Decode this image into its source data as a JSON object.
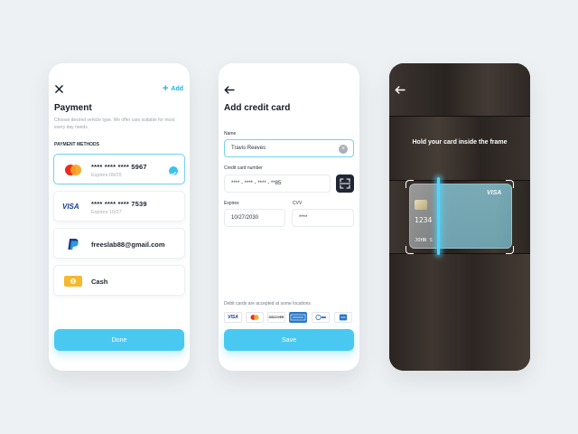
{
  "payment_screen": {
    "title": "Payment",
    "add_label": "Add",
    "description": "Choose desired vehicle type. We offer cars suitable for most every day needs.",
    "section_label": "PAYMENT METHODS",
    "methods": [
      {
        "brand": "mastercard",
        "number": "**** **** **** 5967",
        "expires": "Expires 09/25",
        "selected": true
      },
      {
        "brand": "VISA",
        "number": "**** **** **** 7539",
        "expires": "Expires 10/27",
        "selected": false
      },
      {
        "brand": "paypal",
        "label": "freeslab88@gmail.com"
      },
      {
        "brand": "cash",
        "label": "Cash"
      }
    ],
    "done_label": "Done"
  },
  "add_card_screen": {
    "title": "Add credit card",
    "name_label": "Name",
    "name_value": "Travis Reeves",
    "card_number_label": "Credit card number",
    "card_number_value": "**** - **** - **** - **85",
    "expires_label": "Expires",
    "expires_value": "10/27/2030",
    "cvv_label": "CVV",
    "cvv_value": "****",
    "accepted_note": "Debit cards are accepted at some locations",
    "brands": [
      "VISA",
      "mastercard",
      "DISCOVER",
      "AMERICAN EXPRESS",
      "diners club",
      "AMEX"
    ],
    "visa_brand_text": "VISA",
    "discover_brand_text": "DISCOVER",
    "save_label": "Save"
  },
  "scan_screen": {
    "instruction": "Hold your card inside the frame",
    "card_brand": "VISA",
    "card_digits": "1234",
    "card_holder": "JOHN S"
  },
  "colors": {
    "accent": "#49c9f1",
    "background": "#eef1f3",
    "wood": "#2a2623"
  },
  "icons": [
    "close-icon",
    "plus-icon",
    "check-icon",
    "back-arrow-icon",
    "clear-icon",
    "scan-icon"
  ]
}
